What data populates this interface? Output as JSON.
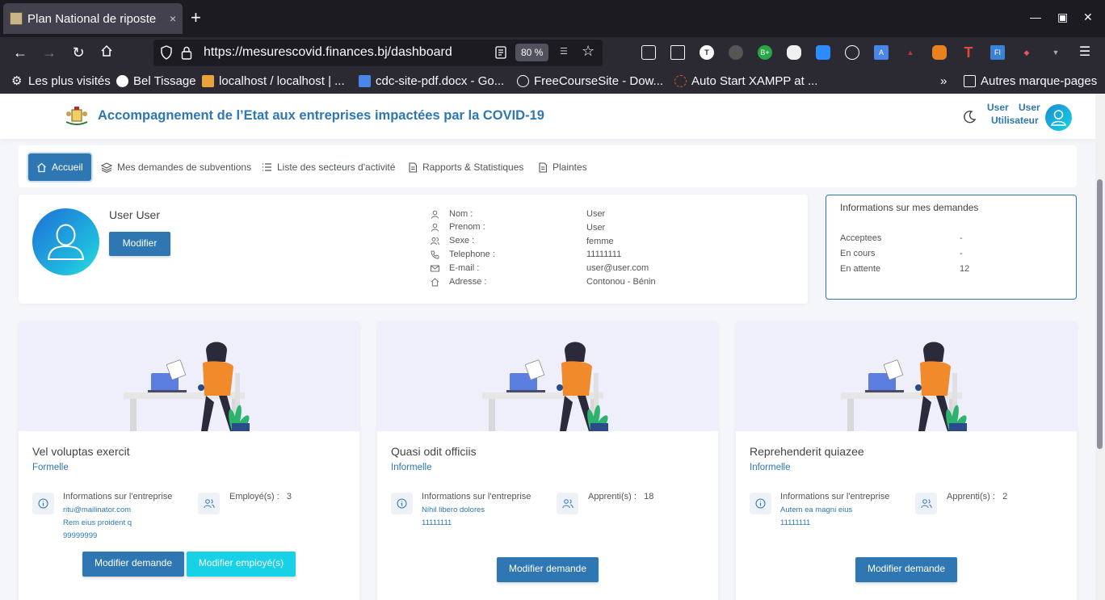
{
  "browser": {
    "tab_title": "Plan National de riposte",
    "tab_close": "×",
    "url": "https://mesurescovid.finances.bj/dashboard",
    "zoom": "80 %",
    "bookmarks": [
      {
        "label": "Les plus visités",
        "color": "#fbfbfe"
      },
      {
        "label": "Bel Tissage",
        "color": "#fbfbfe"
      },
      {
        "label": "localhost / localhost | ...",
        "color": "#e8a33b"
      },
      {
        "label": "cdc-site-pdf.docx - Go...",
        "color": "#4a86e8"
      },
      {
        "label": "FreeCourseSite - Dow...",
        "color": "#fbfbfe"
      },
      {
        "label": "Auto Start XAMPP at ...",
        "color": "#e05a2a"
      }
    ],
    "other_bookmarks": "Autres marque-pages"
  },
  "header": {
    "title": "Accompagnement de l’Etat aux entreprises impactées par la COVID-19",
    "user_first": "User",
    "user_last": "User",
    "user_role": "Utilisateur"
  },
  "menu": {
    "items": [
      {
        "label": "Accueil",
        "icon": "home-icon",
        "active": true
      },
      {
        "label": "Mes demandes de subventions",
        "icon": "layers-icon"
      },
      {
        "label": "Liste des secteurs d'activité",
        "icon": "list-icon"
      },
      {
        "label": "Rapports & Statistiques",
        "icon": "document-icon"
      },
      {
        "label": "Plaintes",
        "icon": "document-icon"
      }
    ]
  },
  "profile": {
    "name": "User User",
    "edit_label": "Modifier",
    "fields": [
      {
        "label": "Nom :",
        "value": "User",
        "icon": "user-icon"
      },
      {
        "label": "Prenom :",
        "value": "User",
        "icon": "user-icon"
      },
      {
        "label": "Sexe :",
        "value": "femme",
        "icon": "users-icon"
      },
      {
        "label": "Telephone :",
        "value": "11111111",
        "icon": "phone-icon"
      },
      {
        "label": "E-mail :",
        "value": "user@user.com",
        "icon": "mail-icon"
      },
      {
        "label": "Adresse :",
        "value": "Contonou - Bénin",
        "icon": "home-icon"
      }
    ]
  },
  "demandes": {
    "title": "Informations sur mes demandes",
    "rows": [
      {
        "label": "Acceptees",
        "value": "-"
      },
      {
        "label": "En cours",
        "value": "-"
      },
      {
        "label": "En attente",
        "value": "12"
      }
    ]
  },
  "cards": [
    {
      "title": "Vel voluptas exercit",
      "type": "Formelle",
      "info_label": "Informations sur l'entreprise",
      "info_lines": [
        "ritu@mailinator.com",
        "Rem eius proident q",
        "99999999"
      ],
      "staff_label": "Employé(s) :",
      "staff_count": "3",
      "btn_primary": "Modifier demande",
      "btn_secondary": "Modifier employé(s)"
    },
    {
      "title": "Quasi odit officiis",
      "type": "Informelle",
      "info_label": "Informations sur l'entreprise",
      "info_lines": [
        "Nihil libero dolores",
        "11111111"
      ],
      "staff_label": "Apprenti(s) :",
      "staff_count": "18",
      "btn_primary": "Modifier demande"
    },
    {
      "title": "Reprehenderit quiazee",
      "type": "Informelle",
      "info_label": "Informations sur l'entreprise",
      "info_lines": [
        "Autem ea magni eius",
        "11111111"
      ],
      "staff_label": "Apprenti(s) :",
      "staff_count": "2",
      "btn_primary": "Modifier demande"
    }
  ]
}
